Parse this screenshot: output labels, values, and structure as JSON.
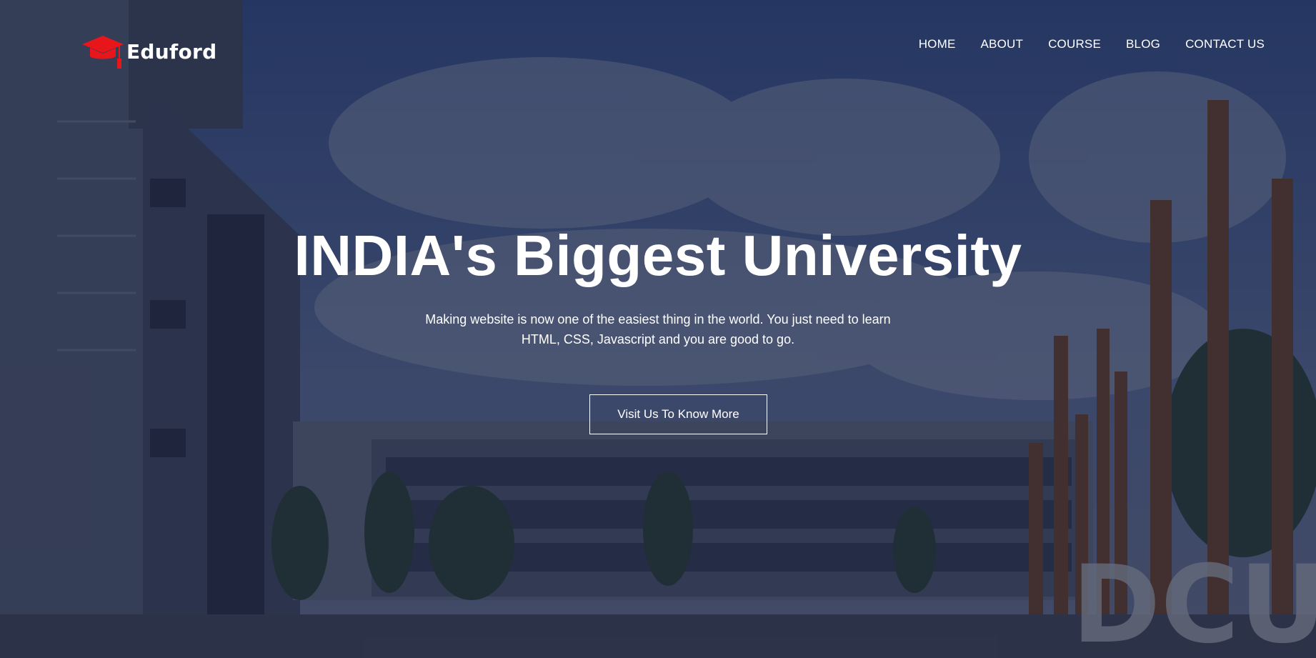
{
  "brand": {
    "name": "Eduford",
    "accent_color": "#e8151b",
    "logo_icon": "graduation-cap-icon"
  },
  "nav": {
    "items": [
      {
        "label": "HOME"
      },
      {
        "label": "ABOUT"
      },
      {
        "label": "COURSE"
      },
      {
        "label": "BLOG"
      },
      {
        "label": "CONTACT US"
      }
    ]
  },
  "hero": {
    "headline": "INDIA's Biggest University",
    "subtext": "Making website is now one of the easiest thing in the world. You just need to learn HTML, CSS, Javascript and you are good to go.",
    "cta_label": "Visit Us To Know More",
    "background_sign": "DCU",
    "overlay_color": "#141a34"
  }
}
